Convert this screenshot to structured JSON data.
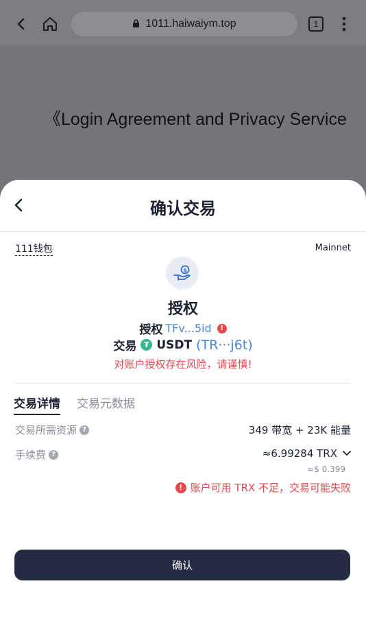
{
  "browser": {
    "url": "1011.haiwaiym.top",
    "tab_count": "1"
  },
  "background_page": {
    "title": "《Login Agreement and Privacy Service"
  },
  "sheet": {
    "title": "确认交易",
    "wallet_name": "111钱包",
    "network": "Mainnet",
    "action_title": "授权",
    "approve_label": "授权",
    "approve_address": "TFv...5id",
    "trade_label": "交易",
    "token_symbol": "USDT",
    "token_address": "(TR···j6t)",
    "risk_warning": "对账户授权存在风险，请谨慎!",
    "tabs": [
      "交易详情",
      "交易元数据"
    ],
    "resource_label": "交易所需资源",
    "resource_value": "349 带宽 + 23K 能量",
    "fee_label": "手续费",
    "fee_value": "≈6.99284 TRX",
    "fee_usd": "≈$ 0.399",
    "insufficient_warning": "账户可用 TRX 不足，交易可能失败",
    "confirm_label": "确认"
  },
  "colors": {
    "accent_dark": "#252b42",
    "link_blue": "#4a86d6",
    "danger": "#e5484d",
    "token_green": "#3cb391"
  }
}
